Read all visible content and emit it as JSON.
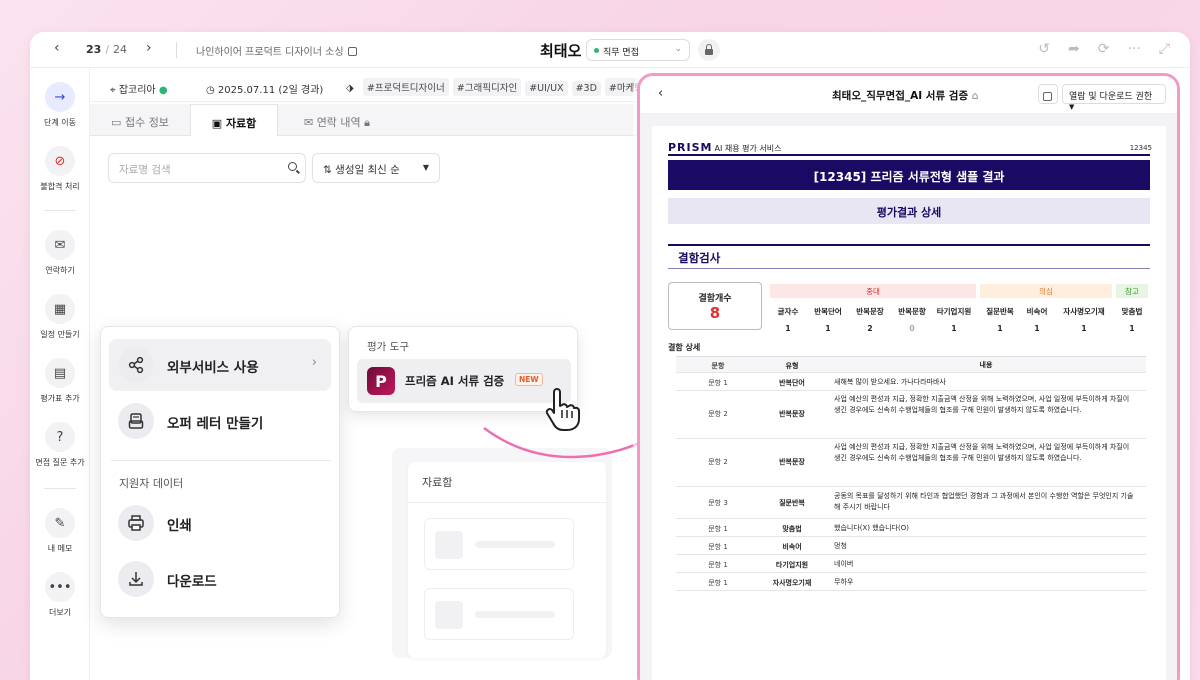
{
  "topbar": {
    "page_current": "23",
    "page_sep": "/",
    "page_total": "24",
    "job_title": "나인하이어 프로덕트 디자이너 소싱",
    "candidate_name": "최태오",
    "stage": "직무 면접"
  },
  "sidebar": {
    "items": [
      {
        "label": "단계 이동",
        "icon": "arrow-right-icon"
      },
      {
        "label": "불합격 처리",
        "icon": "ban-icon"
      },
      {
        "label": "연락하기",
        "icon": "mail-icon"
      },
      {
        "label": "일정 만들기",
        "icon": "calendar-icon"
      },
      {
        "label": "평가표 추가",
        "icon": "clipboard-icon"
      },
      {
        "label": "면접 질문 추가",
        "icon": "question-icon"
      },
      {
        "label": "내 메모",
        "icon": "edit-icon"
      },
      {
        "label": "더보기",
        "icon": "more-icon"
      }
    ]
  },
  "info": {
    "source": "잡코리아",
    "date": "2025.07.11 (2일 경과)",
    "tags": [
      "#프로덕트디자이너",
      "#그래픽디자인",
      "#UI/UX",
      "#3D",
      "#마케팅"
    ]
  },
  "tabs": [
    {
      "label": "접수 정보"
    },
    {
      "label": "자료함"
    },
    {
      "label": "연락 내역"
    }
  ],
  "filters": {
    "search_placeholder": "자료명 검색",
    "sort_label": "생성일 최신 순"
  },
  "file_panel": {
    "title": "자료함"
  },
  "menu": {
    "external_service": "외부서비스 사용",
    "offer_letter": "오퍼 레터 만들기",
    "section_title": "지원자 데이터",
    "print": "인쇄",
    "download": "다운로드"
  },
  "tool": {
    "title": "평가 도구",
    "item_name": "프리즘 AI 서류 검증",
    "badge": "NEW",
    "logo_letter": "P"
  },
  "pdf": {
    "title": "최태오_직무면접_AI 서류 검증",
    "permission_label": "열람 및 다운로드 권한",
    "brand": "PRISM",
    "brand_sub": "AI 채용 평가 서비스",
    "doc_no": "12345",
    "banner": "[12345] 프리즘 서류전형 샘플 결과",
    "sub_banner": "평가결과 상세",
    "section": "결함검사",
    "count_label": "결함개수",
    "count_value": "8",
    "groups": {
      "major": "중대",
      "doubt": "의심",
      "ref": "참고"
    },
    "columns": [
      "글자수",
      "반복단어",
      "반복문장",
      "반복문항",
      "타기업지원",
      "질문반복",
      "비속어",
      "자사명오기재",
      "맞춤법"
    ],
    "counts": [
      "1",
      "1",
      "2",
      "0",
      "1",
      "1",
      "1",
      "1",
      "1"
    ],
    "detail_title": "결함 상세",
    "detail_headers": {
      "q": "문항",
      "type": "유형",
      "content": "내용"
    },
    "details": [
      {
        "q": "문항 1",
        "type": "반복단어",
        "content": "새해복 많이 받으세요. 가나다라마바사"
      },
      {
        "q": "문항 2",
        "type": "반복문장",
        "content": "사업 예산의 편성과 지급, 정확한 지출금액 산정을 위해 노력하였으며, 사업 일정에 부득이하게 차질이 생긴 경우에도 신속히 수행업체들의 협조를 구해 민원이 발생하지 않도록 하였습니다."
      },
      {
        "q": "문항 2",
        "type": "반복문장",
        "content": "사업 예산의 편성과 지급, 정확한 지출금액 산정을 위해 노력하였으며, 사업 일정에 부득이하게 차질이 생긴 경우에도 신속히 수행업체들의 협조를 구해 민원이 발생하지 않도록 하였습니다."
      },
      {
        "q": "문항 3",
        "type": "질문반복",
        "content": "공동의 목표를 달성하기 위해 타인과 협업했던 경험과 그 과정에서 본인이 수행한 역할은 무엇인지 기술해 주시기 바랍니다"
      },
      {
        "q": "문항 1",
        "type": "맞춤법",
        "content": "했습니다(X) 했습니다(O)"
      },
      {
        "q": "문항 1",
        "type": "비속어",
        "content": "멍청"
      },
      {
        "q": "문항 1",
        "type": "타기업지원",
        "content": "네이버"
      },
      {
        "q": "문항 1",
        "type": "자사명오기재",
        "content": "무하우"
      }
    ]
  },
  "colors": {
    "accent": "#1b0a63",
    "highlight_border": "#f29ac6",
    "danger": "#e03030",
    "success": "#2bb673"
  }
}
